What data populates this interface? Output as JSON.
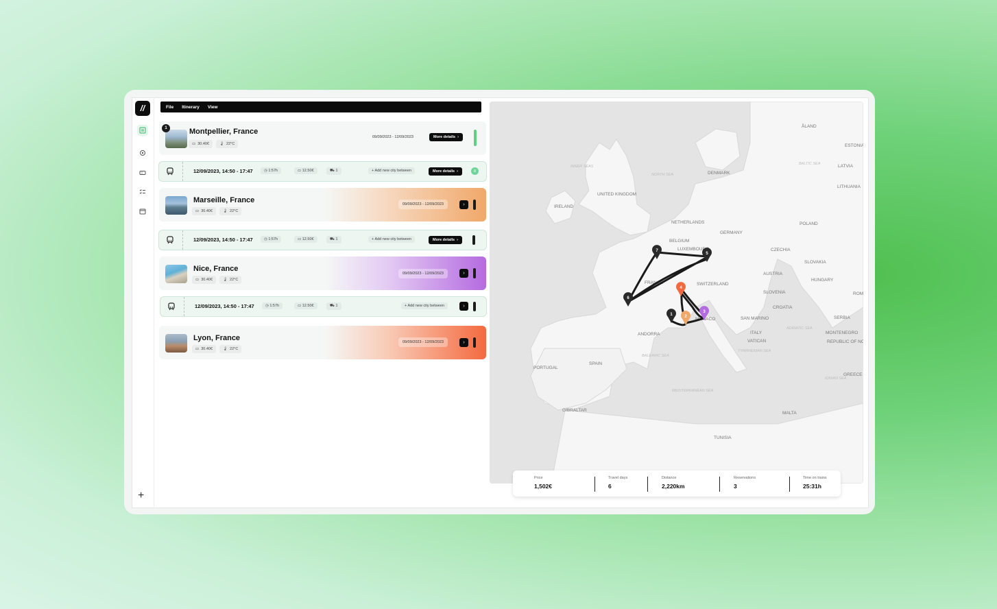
{
  "app": {
    "logo": "//"
  },
  "menu": [
    "File",
    "Itinerary",
    "View"
  ],
  "rail_icons": [
    "list-icon",
    "settings-icon",
    "ticket-icon",
    "checklist-icon",
    "calendar-icon"
  ],
  "stops": [
    {
      "name": "Montpellier, France",
      "badge": "1",
      "price": "30.40€",
      "temp": "22°C",
      "dates": "09/09/2023 - 12/09/2023",
      "details": "More details"
    },
    {
      "name": "Marseille, France",
      "price": "30.40€",
      "temp": "22°C",
      "dates": "09/09/2023 - 12/09/2023"
    },
    {
      "name": "Nice, France",
      "price": "30.40€",
      "temp": "22°C",
      "dates": "09/09/2023 - 12/09/2023"
    },
    {
      "name": "Lyon, France",
      "price": "30.40€",
      "temp": "22°C",
      "dates": "09/09/2023 - 12/09/2023"
    }
  ],
  "legs": [
    {
      "time": "12/09/2023, 14:50 - 17:47",
      "duration": "1:57h",
      "price": "12.50€",
      "seats": "1",
      "add": "Add new city between",
      "details": "More details",
      "status": "8"
    },
    {
      "time": "12/09/2023, 14:50 - 17:47",
      "duration": "1:57h",
      "price": "12.50€",
      "seats": "1",
      "add": "Add new city between",
      "details": "More details"
    },
    {
      "time": "12/09/2023, 14:50 - 17:47",
      "duration": "1:57h",
      "price": "12.50€",
      "seats": "1",
      "add": "Add new city between"
    }
  ],
  "map": {
    "labels": [
      "ÅLAND",
      "ESTONIA",
      "LATVIA",
      "LITHUANIA",
      "INNER SEAS",
      "NORTH SEA",
      "DENMARK",
      "BALTIC SEA",
      "UNITED KINGDOM",
      "IRELAND",
      "NETHERLANDS",
      "POLAND",
      "GERMANY",
      "BELGIUM",
      "LUXEMBOURG",
      "CZECHIA",
      "SLOVAKIA",
      "FRANCE",
      "SWITZERLAND",
      "AUSTRIA",
      "HUNGARY",
      "SLOVENIA",
      "CROATIA",
      "ROM",
      "SAN MARINO",
      "SERBIA",
      "ADRIATIC SEA",
      "MONTENEGRO",
      "ANDORRA",
      "ITALY",
      "VATICAN",
      "REPUBLIC OF NO MACEDONIA",
      "MONACO",
      "TYRRHENIAN SEA",
      "SPAIN",
      "BALEARIC SEA",
      "PORTUGAL",
      "IONIAN SEA",
      "GREECE",
      "MEDITERRANEAN SEA",
      "GIBRALTAR",
      "MALTA",
      "TUNISIA"
    ],
    "pins": [
      "1",
      "2",
      "3",
      "4",
      "5",
      "6",
      "7"
    ]
  },
  "stats": [
    {
      "label": "Price",
      "value": "1,502€"
    },
    {
      "label": "Travel days",
      "value": "6"
    },
    {
      "label": "Distance",
      "value": "2,220km"
    },
    {
      "label": "Reservations",
      "value": "3"
    },
    {
      "label": "Time on trains",
      "value": "25:31h"
    }
  ],
  "colors": {
    "accent": "#5fcf86",
    "marseille": "#f0a86a",
    "nice": "#b46be0",
    "lyon": "#f46a40",
    "dark": "#0d0d0d"
  }
}
